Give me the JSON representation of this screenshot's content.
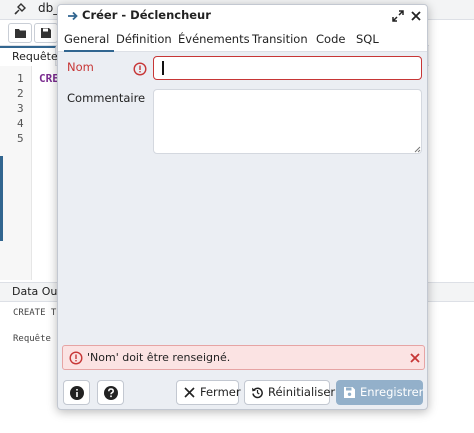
{
  "background": {
    "db_label": "db_",
    "query_tab": "Requête",
    "line_numbers": [
      "1",
      "2",
      "3",
      "4",
      "5"
    ],
    "code_keyword": "CRE",
    "output_tab": "Data Outp",
    "output_line1": "CREATE T",
    "output_line2": "Requête "
  },
  "dialog": {
    "title": "Créer - Déclencheur",
    "tabs": [
      {
        "label": "General",
        "active": true
      },
      {
        "label": "Définition"
      },
      {
        "label": "Événements"
      },
      {
        "label": "Transition"
      },
      {
        "label": "Code"
      },
      {
        "label": "SQL"
      }
    ],
    "form": {
      "name_label": "Nom",
      "name_value": "",
      "comment_label": "Commentaire",
      "comment_value": ""
    },
    "error_message": "'Nom' doit être renseigné.",
    "buttons": {
      "close": "Fermer",
      "reset": "Réinitialiser",
      "save": "Enregistrer"
    }
  },
  "colors": {
    "accent": "#326690",
    "error": "#c73636",
    "error_bg": "#fbe3e3",
    "save_disabled": "#93b0ca"
  },
  "icons": [
    "trigger-arrow-icon",
    "expand-icon",
    "close-icon",
    "warning-icon",
    "info-icon",
    "help-icon",
    "reset-icon",
    "save-icon"
  ]
}
